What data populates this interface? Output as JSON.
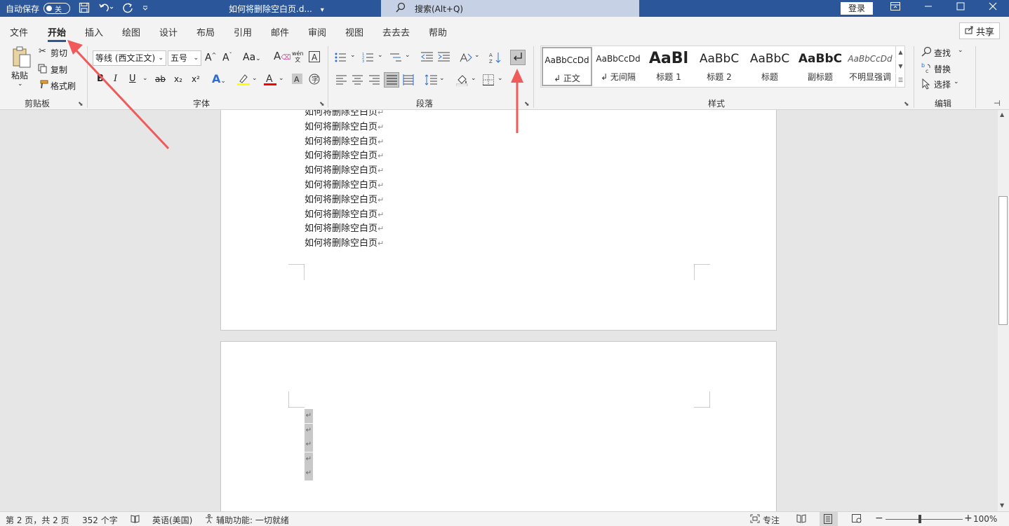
{
  "titlebar": {
    "autosave_label": "自动保存",
    "autosave_state": "关",
    "doc_title": "如何将删除空白页.d...",
    "doc_dropdown": "⌄",
    "search_placeholder": "搜索(Alt+Q)",
    "login": "登录",
    "icons": [
      "save-icon",
      "undo-icon",
      "redo-icon",
      "customize-icon"
    ]
  },
  "tabs": [
    "文件",
    "开始",
    "插入",
    "绘图",
    "设计",
    "布局",
    "引用",
    "邮件",
    "审阅",
    "视图",
    "去去去",
    "帮助"
  ],
  "active_tab": "开始",
  "share_label": "共享",
  "clipboard": {
    "paste": "粘贴",
    "cut": "剪切",
    "copy": "复制",
    "format_painter": "格式刷",
    "group": "剪贴板"
  },
  "font": {
    "family": "等线 (西文正文)",
    "size": "五号",
    "group": "字体",
    "bold": "B",
    "italic": "I",
    "underline": "U",
    "strikethrough": "ab",
    "subscript": "x₂",
    "superscript": "x²",
    "grow": "A^",
    "shrink": "Aˇ",
    "case": "Aa",
    "phonetic": "wén",
    "highlight_color": "#ffff00",
    "font_color": "#ff0000"
  },
  "paragraph": {
    "group": "段落"
  },
  "styles": {
    "group": "样式",
    "items": [
      {
        "preview": "AaBbCcDd",
        "name": "↲ 正文"
      },
      {
        "preview": "AaBbCcDd",
        "name": "↲ 无间隔"
      },
      {
        "preview": "AaBl",
        "name": "标题 1"
      },
      {
        "preview": "AaBbC",
        "name": "标题 2"
      },
      {
        "preview": "AaBbC",
        "name": "标题"
      },
      {
        "preview": "AaBbC",
        "name": "副标题"
      },
      {
        "preview": "AaBbCcDd",
        "name": "不明显强调"
      }
    ]
  },
  "editing": {
    "group": "编辑",
    "find": "查找",
    "replace": "替换",
    "select": "选择"
  },
  "document": {
    "page1_lines": [
      "如何将删除空白页",
      "如何将删除空白页",
      "如何将删除空白页",
      "如何将删除空白页",
      "如何将删除空白页",
      "如何将删除空白页",
      "如何将删除空白页",
      "如何将删除空白页",
      "如何将删除空白页",
      "如何将删除空白页"
    ],
    "paragraph_mark": "↵",
    "empty_paragraphs": 5
  },
  "statusbar": {
    "page": "第 2 页，共 2 页",
    "words": "352 个字",
    "language": "英语(美国)",
    "accessibility": "辅助功能: 一切就绪",
    "focus": "专注",
    "zoom": "100%",
    "zoom_level": 1.0
  },
  "annotation_color": "#f05a5a"
}
